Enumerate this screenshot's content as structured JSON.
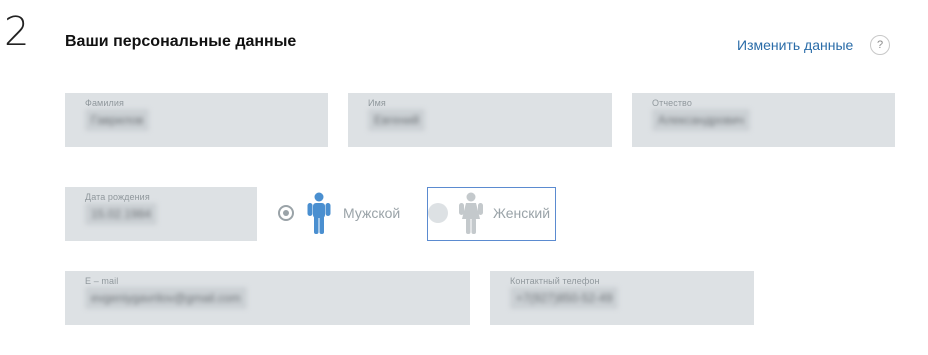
{
  "section": {
    "step_number": "2",
    "title": "Ваши персональные данные",
    "edit_link": "Изменить данные",
    "help_symbol": "?"
  },
  "fields": {
    "last_name": {
      "label": "Фамилия",
      "value": "Гаврилов"
    },
    "first_name": {
      "label": "Имя",
      "value": "Евгений"
    },
    "patronymic": {
      "label": "Отчество",
      "value": "Александрович"
    },
    "birth_date": {
      "label": "Дата рождения",
      "value": "15.02.1984"
    },
    "email": {
      "label": "E – mail",
      "value": "evgeniygavrilov@gmail.com"
    },
    "phone": {
      "label": "Контактный телефон",
      "value": "+7(927)850-52-49"
    }
  },
  "gender": {
    "male_label": "Мужской",
    "female_label": "Женский",
    "selected": "male"
  },
  "colors": {
    "field_bg": "#dde1e4",
    "link": "#2a6ca8",
    "male_icon": "#4a8fd0",
    "female_icon": "#c4c9cc",
    "focus_border": "#5b8bd0"
  },
  "icons": {
    "male": "male-person-icon",
    "female": "female-person-icon",
    "help": "question-circle-icon"
  }
}
